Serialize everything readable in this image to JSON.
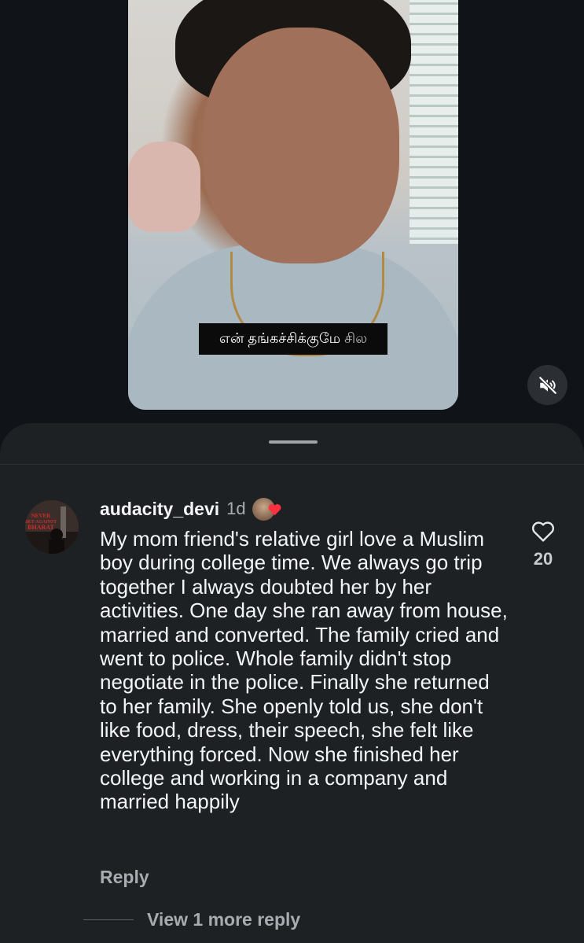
{
  "video": {
    "caption_main": "என் தங்கச்சிக்குமே",
    "caption_faded": "சில"
  },
  "icons": {
    "mute": "speaker-muted-icon",
    "like": "heart-outline-icon",
    "reaction": "heart-icon"
  },
  "colors": {
    "reaction_heart": "#ff3040"
  },
  "comment": {
    "username": "audacity_devi",
    "time": "1d",
    "avatar_text": "NEVER BET AGAINST BHARAT",
    "text": "My mom friend's relative girl love a Muslim boy during college time. We always go trip together I always doubted her by her activities. One day she ran away from house, married and converted. The family cried and went to police. Whole family didn't stop negotiate in the police. Finally she returned to her family. She openly told us, she don't like food, dress, their speech, she felt like everything forced. Now she finished her college and working in a company and married happily",
    "like_count": "20",
    "reply_label": "Reply",
    "view_more_label": "View 1 more reply"
  }
}
